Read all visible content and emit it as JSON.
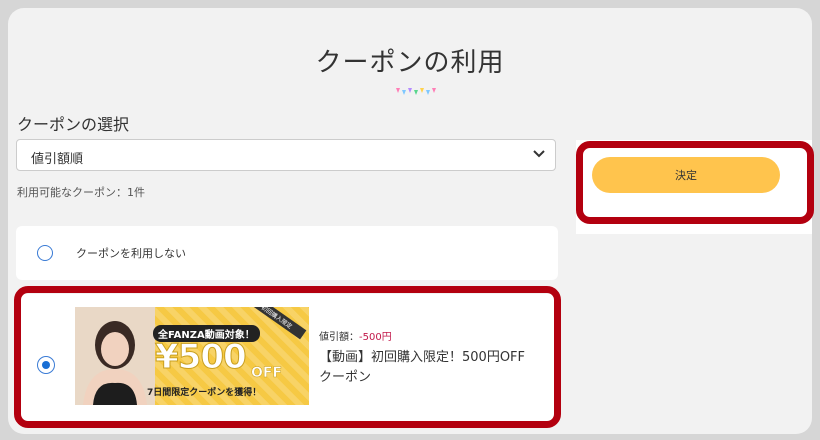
{
  "page": {
    "title": "クーポンの利用"
  },
  "section": {
    "title": "クーポンの選択"
  },
  "sort_select": {
    "value": "値引額順"
  },
  "available_count_text": "利用可能なクーポン：1件",
  "options": {
    "none_label": "クーポンを利用しない",
    "coupon": {
      "discount_label": "値引額：",
      "discount_amount": "-500円",
      "name": "【動画】初回購入限定！500円OFFクーポン",
      "banner": {
        "tag": "全FANZA動画対象！",
        "amount": "¥500",
        "unit": "OFF",
        "subtitle": "7日間限定クーポンを獲得！",
        "ribbon": "初回購入限定"
      }
    }
  },
  "confirm_button": {
    "label": "決定"
  },
  "colors": {
    "accent_button": "#ffc44d",
    "discount_text": "#c2184a",
    "radio": "#1a6fd4",
    "highlight": "#b3000f"
  }
}
